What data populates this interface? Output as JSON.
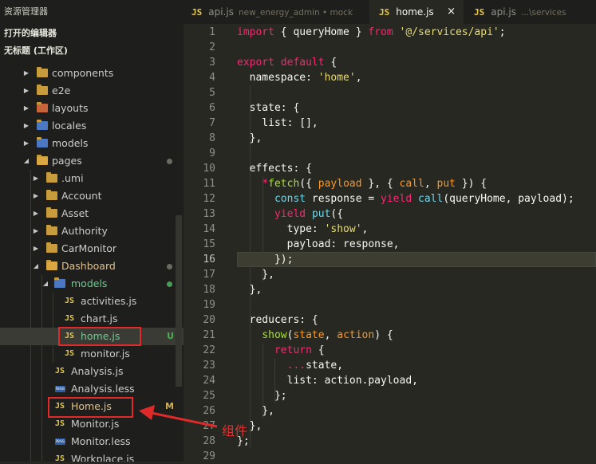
{
  "sidebar": {
    "title": "资源管理器",
    "open_editors": "打开的编辑器",
    "workspace": "无标题 (工作区)",
    "items": [
      {
        "label": "components",
        "type": "folder",
        "depth": 1
      },
      {
        "label": "e2e",
        "type": "folder",
        "depth": 1
      },
      {
        "label": "layouts",
        "type": "folder",
        "depth": 1
      },
      {
        "label": "locales",
        "type": "folder",
        "depth": 1
      },
      {
        "label": "models",
        "type": "folder",
        "depth": 1
      },
      {
        "label": "pages",
        "type": "folder-open",
        "depth": 1
      },
      {
        "label": ".umi",
        "type": "folder",
        "depth": 2
      },
      {
        "label": "Account",
        "type": "folder",
        "depth": 2
      },
      {
        "label": "Asset",
        "type": "folder",
        "depth": 2
      },
      {
        "label": "Authority",
        "type": "folder",
        "depth": 2
      },
      {
        "label": "CarMonitor",
        "type": "folder",
        "depth": 2
      },
      {
        "label": "Dashboard",
        "type": "folder-open",
        "depth": 2
      },
      {
        "label": "models",
        "type": "folder-open",
        "depth": 3
      },
      {
        "label": "activities.js",
        "type": "js",
        "depth": 4
      },
      {
        "label": "chart.js",
        "type": "js",
        "depth": 4
      },
      {
        "label": "home.js",
        "type": "js",
        "depth": 4
      },
      {
        "label": "monitor.js",
        "type": "js",
        "depth": 4
      },
      {
        "label": "Analysis.js",
        "type": "js",
        "depth": 3
      },
      {
        "label": "Analysis.less",
        "type": "less",
        "depth": 3
      },
      {
        "label": "Home.js",
        "type": "js",
        "depth": 3
      },
      {
        "label": "Monitor.js",
        "type": "js",
        "depth": 3
      },
      {
        "label": "Monitor.less",
        "type": "less",
        "depth": 3
      },
      {
        "label": "Workplace.js",
        "type": "js",
        "depth": 3
      }
    ],
    "badges": {
      "u": "U",
      "m": "M"
    }
  },
  "tabs": [
    {
      "icon": "JS",
      "name": "api.js",
      "desc": "new_energy_admin • mock"
    },
    {
      "icon": "JS",
      "name": "home.js",
      "desc": "",
      "close": "×"
    },
    {
      "icon": "JS",
      "name": "api.js",
      "desc": "...\\services"
    }
  ],
  "editor": {
    "line_numbers": [
      "1",
      "2",
      "3",
      "4",
      "5",
      "6",
      "7",
      "8",
      "9",
      "10",
      "11",
      "12",
      "13",
      "14",
      "15",
      "16",
      "17",
      "18",
      "19",
      "20",
      "21",
      "22",
      "23",
      "24",
      "25",
      "26",
      "27",
      "28",
      "29"
    ],
    "current_line": 16
  },
  "annotation": {
    "text": "组件",
    "color": "#e03030"
  }
}
